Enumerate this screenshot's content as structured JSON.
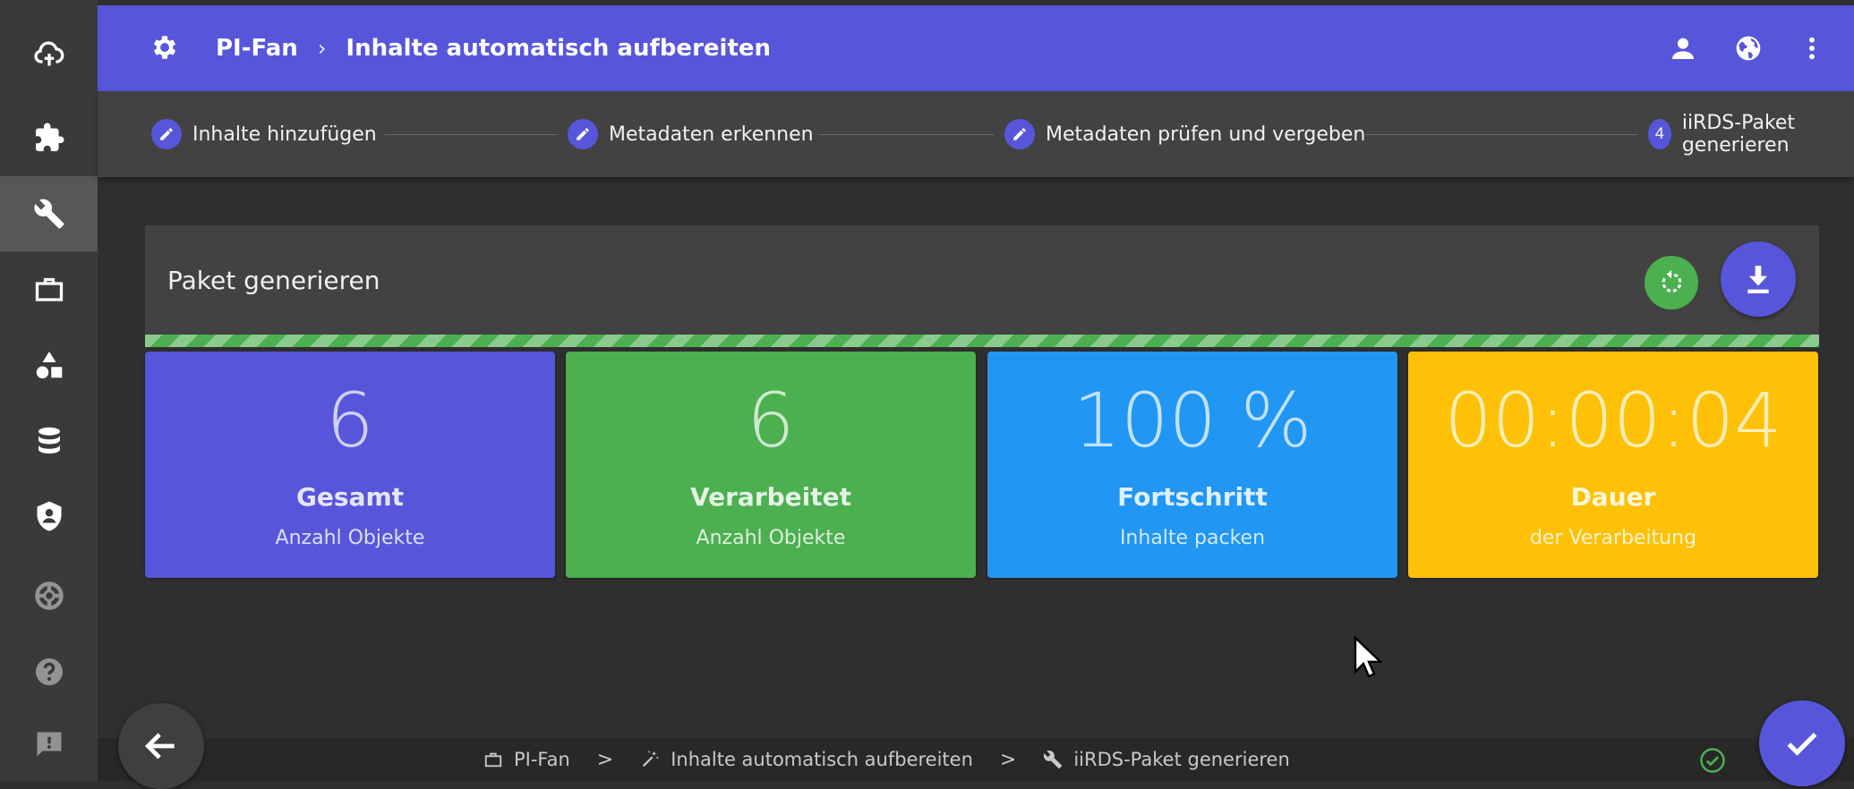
{
  "header": {
    "project": "PI-Fan",
    "separator": "›",
    "title": "Inhalte automatisch aufbereiten",
    "color": "#5756db"
  },
  "sidebar": {
    "items": [
      {
        "icon": "cloud-upload-icon"
      },
      {
        "icon": "puzzle-icon"
      },
      {
        "icon": "wrench-icon",
        "active": true
      },
      {
        "icon": "briefcase-icon"
      },
      {
        "icon": "shapes-icon"
      },
      {
        "icon": "database-icon"
      },
      {
        "icon": "shield-user-icon"
      },
      {
        "icon": "lifebuoy-icon"
      },
      {
        "icon": "help-icon"
      },
      {
        "icon": "feedback-icon"
      }
    ]
  },
  "stepper": {
    "steps": [
      {
        "label": "Inhalte hinzufügen",
        "icon": "pencil-icon"
      },
      {
        "label": "Metadaten erkennen",
        "icon": "pencil-icon"
      },
      {
        "label": "Metadaten prüfen und vergeben",
        "icon": "pencil-icon"
      },
      {
        "label": "iiRDS-Paket generieren",
        "number": "4"
      }
    ]
  },
  "card": {
    "title": "Paket generieren",
    "progress_percent": 100
  },
  "tiles": [
    {
      "value": "6",
      "label": "Gesamt",
      "sub": "Anzahl Objekte",
      "color": "#5756db"
    },
    {
      "value": "6",
      "label": "Verarbeitet",
      "sub": "Anzahl Objekte",
      "color": "#4caf50"
    },
    {
      "value": "100 %",
      "label": "Fortschritt",
      "sub": "Inhalte packen",
      "color": "#2196f3"
    },
    {
      "value": "00:00:04",
      "label": "Dauer",
      "sub": "der Verarbeitung",
      "color": "#ffc107"
    }
  ],
  "footer": {
    "crumbs": [
      "PI-Fan",
      "Inhalte automatisch aufbereiten",
      "iiRDS-Paket generieren"
    ],
    "separator": ">"
  }
}
